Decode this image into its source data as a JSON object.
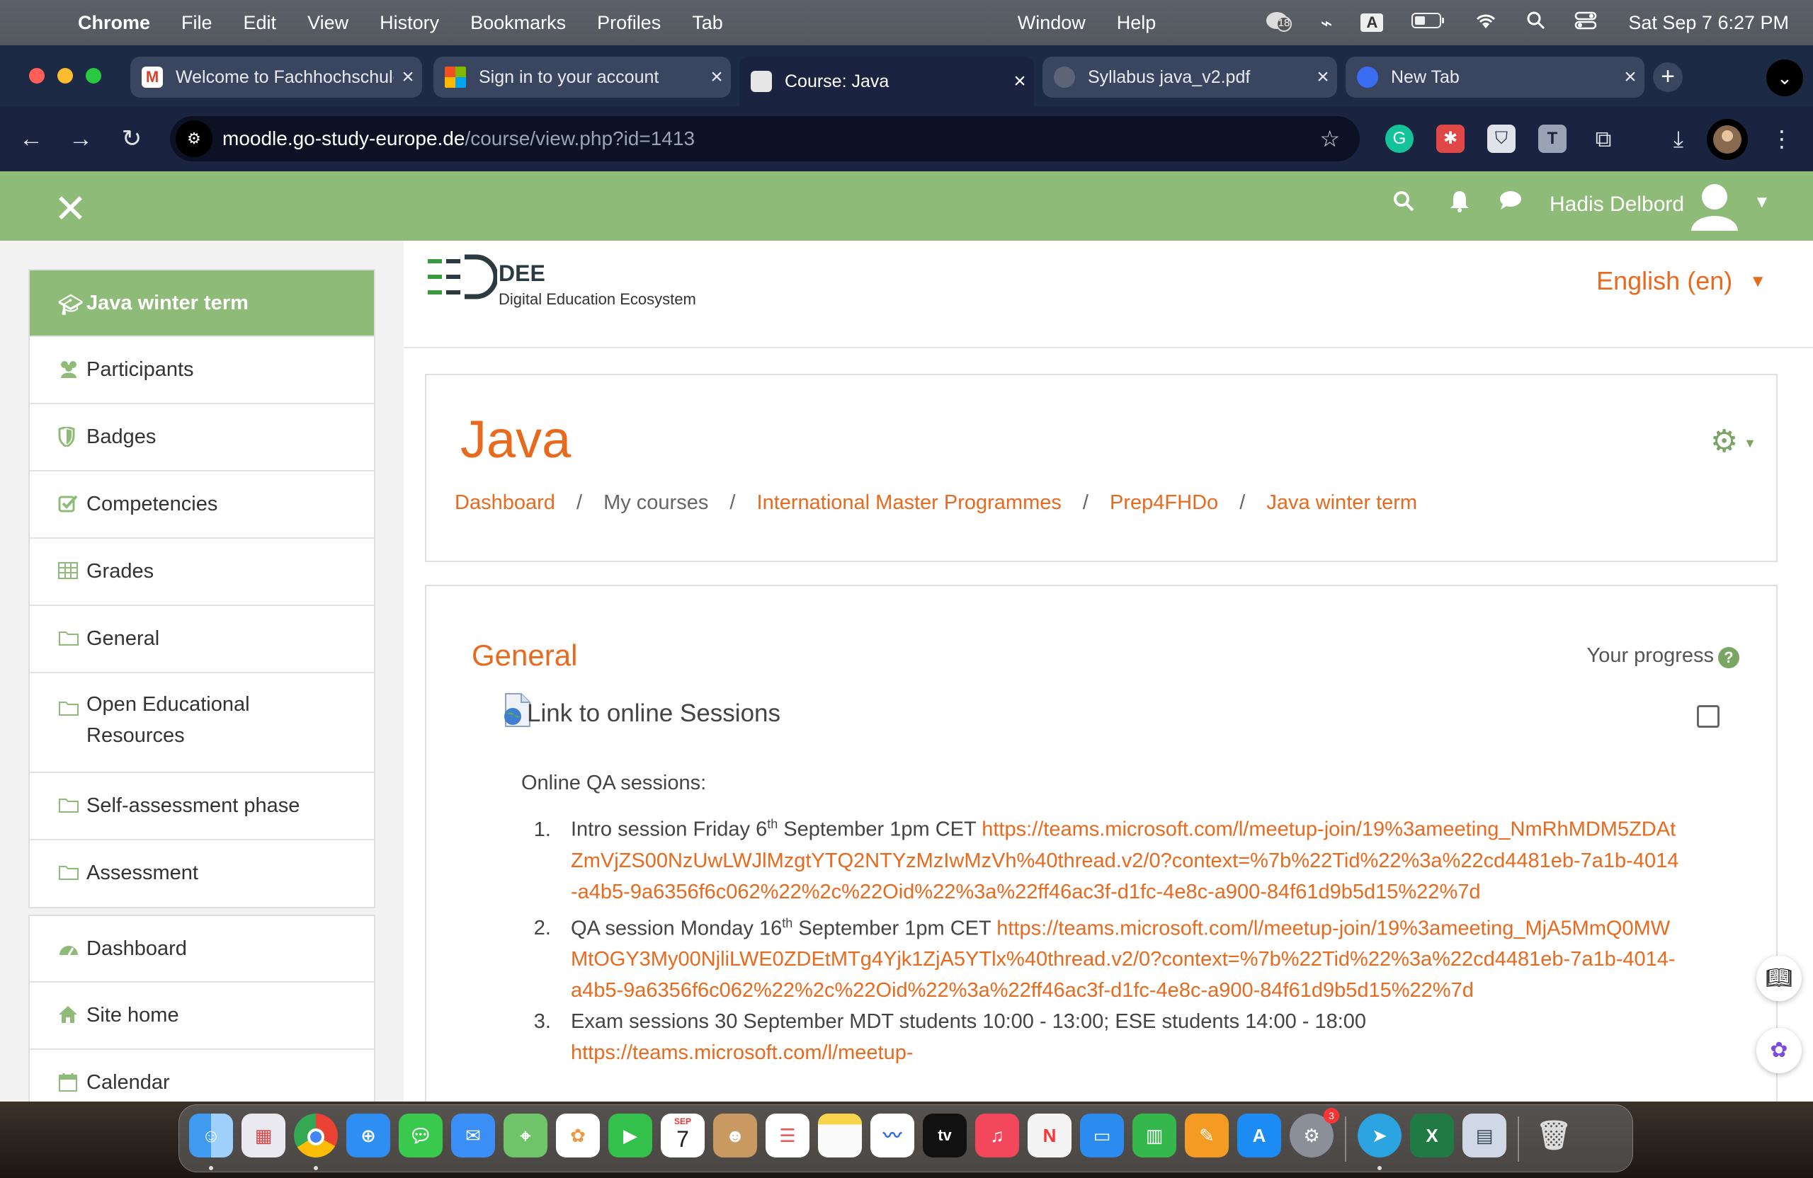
{
  "menubar": {
    "app_name": "Chrome",
    "items": [
      "File",
      "Edit",
      "View",
      "History",
      "Bookmarks",
      "Profiles",
      "Tab",
      "Window",
      "Help"
    ],
    "notification_count": "18",
    "clock": "Sat Sep 7  6:27 PM"
  },
  "tabs": [
    {
      "title": "Welcome to Fachhochschule",
      "favicon_color": "#d9412d",
      "active": false
    },
    {
      "title": "Sign in to your account",
      "favicon_color": "#f25022",
      "active": false
    },
    {
      "title": "Course: Java",
      "favicon_color": "#cfd4dc",
      "active": true
    },
    {
      "title": "Syllabus java_v2.pdf",
      "favicon_color": "#6b7486",
      "active": false
    },
    {
      "title": "New Tab",
      "favicon_color": "#3b6df2",
      "active": false
    }
  ],
  "address": {
    "host": "moodle.go-study-europe.de",
    "path": "/course/view.php?id=1413"
  },
  "navbar": {
    "user_name": "Hadis Delbord",
    "accent": "#8fbb79"
  },
  "drawer": {
    "course_items": [
      {
        "label": "Java winter term",
        "icon": "graduation-cap-icon",
        "active": true
      },
      {
        "label": "Participants",
        "icon": "users-icon"
      },
      {
        "label": "Badges",
        "icon": "shield-icon"
      },
      {
        "label": "Competencies",
        "icon": "checkbox-icon"
      },
      {
        "label": "Grades",
        "icon": "table-icon"
      },
      {
        "label": "General",
        "icon": "folder-icon"
      },
      {
        "label": "Open Educational Resources",
        "icon": "folder-icon"
      },
      {
        "label": "Self-assessment phase",
        "icon": "folder-icon"
      },
      {
        "label": "Assessment",
        "icon": "folder-icon"
      }
    ],
    "site_items": [
      {
        "label": "Dashboard",
        "icon": "dashboard-icon"
      },
      {
        "label": "Site home",
        "icon": "home-icon"
      },
      {
        "label": "Calendar",
        "icon": "calendar-icon"
      }
    ]
  },
  "logo": {
    "name": "DEE",
    "subtitle": "Digital Education Ecosystem"
  },
  "language": "English (en)",
  "course": {
    "title": "Java",
    "breadcrumb": [
      {
        "label": "Dashboard",
        "link": true
      },
      {
        "label": "My courses",
        "link": false
      },
      {
        "label": "International Master Programmes",
        "link": true
      },
      {
        "label": "Prep4FHDo",
        "link": true
      },
      {
        "label": "Java winter term",
        "link": true
      }
    ]
  },
  "section": {
    "title": "General",
    "progress_label": "Your progress",
    "progress_help": "?",
    "activity_name": "Link to online Sessions",
    "summary_heading": "Online QA sessions:",
    "sessions": [
      {
        "text_before": "Intro session Friday 6",
        "sup": "th",
        "text_after": " September 1pm CET ",
        "link": "https://teams.microsoft.com/l/meetup-join/19%3ameeting_NmRhMDM5ZDAtZmVjZS00NzUwLWJlMzgtYTQ2NTYzMzIwMzVh%40thread.v2/0?context=%7b%22Tid%22%3a%22cd4481eb-7a1b-4014-a4b5-9a6356f6c062%22%2c%22Oid%22%3a%22ff46ac3f-d1fc-4e8c-a900-84f61d9b5d15%22%7d"
      },
      {
        "text_before": "QA session Monday 16",
        "sup": "th",
        "text_after": " September 1pm CET ",
        "link": "https://teams.microsoft.com/l/meetup-join/19%3ameeting_MjA5MmQ0MWMtOGY3My00NjliLWE0ZDEtMTg4Yjk1ZjA5YTlx%40thread.v2/0?context=%7b%22Tid%22%3a%22cd4481eb-7a1b-4014-a4b5-9a6356f6c062%22%2c%22Oid%22%3a%22ff46ac3f-d1fc-4e8c-a900-84f61d9b5d15%22%7d"
      },
      {
        "text_before": "Exam sessions 30 September  MDT students 10:00 - 13:00; ESE students 14:00 - 18:00",
        "sup": "",
        "text_after": "",
        "link": "https://teams.microsoft.com/l/meetup-"
      }
    ]
  },
  "dock": {
    "calendar_month": "SEP",
    "calendar_day": "7",
    "tv_label": "tv",
    "settings_badge": "3"
  }
}
